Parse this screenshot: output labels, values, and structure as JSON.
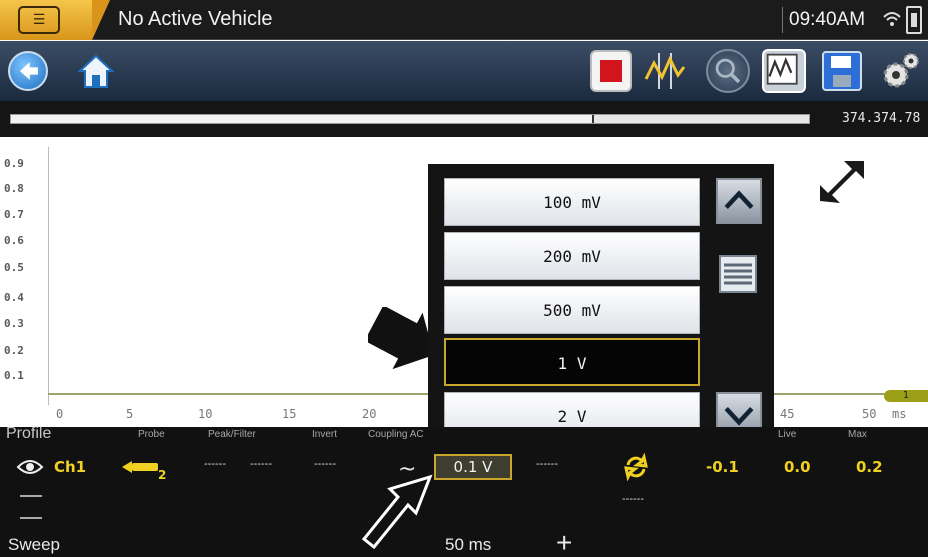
{
  "titlebar": {
    "title": "No Active Vehicle",
    "time": "09:40AM",
    "icons": [
      "vehicle-logo-icon",
      "wifi-icon",
      "battery-icon"
    ]
  },
  "toolbar": {
    "buttons": [
      "back-icon",
      "home-icon",
      "stop-icon",
      "cursor-icon",
      "zoom-icon",
      "waveform-icon",
      "save-icon",
      "settings-icon"
    ]
  },
  "strip": {
    "value": "374.374.78",
    "progress_fraction": 0.73
  },
  "graph": {
    "y_ticks": [
      "0.9",
      "0.8",
      "0.7",
      "0.6",
      "0.5",
      "0.4",
      "0.3",
      "0.2",
      "0.1"
    ],
    "x_ticks": [
      "0",
      "5",
      "10",
      "15",
      "20",
      "45",
      "50"
    ],
    "x_unit": "ms",
    "trigger_label": "1"
  },
  "dropdown": {
    "options": [
      "100 mV",
      "200 mV",
      "500 mV",
      "1 V",
      "2 V"
    ],
    "selected_index": 3
  },
  "panel": {
    "headers": {
      "profile": "Profile",
      "probe": "Probe",
      "peak_filter": "Peak/Filter",
      "invert": "Invert",
      "coupling": "Coupling AC",
      "live": "Live",
      "max": "Max"
    },
    "channel": "Ch1",
    "probe_sub": "2",
    "dash": "------",
    "scale": "0.1 V",
    "min_value": "-0.1",
    "live_value": "0.0",
    "max_value": "0.2",
    "sweep_label": "Sweep",
    "sweep_value": "50 ms",
    "plus": "+"
  },
  "colors": {
    "accent_yellow": "#f0d020",
    "selection_border": "#c8a82a",
    "stop_red": "#d2141c",
    "trigger_green": "#9ba018"
  }
}
